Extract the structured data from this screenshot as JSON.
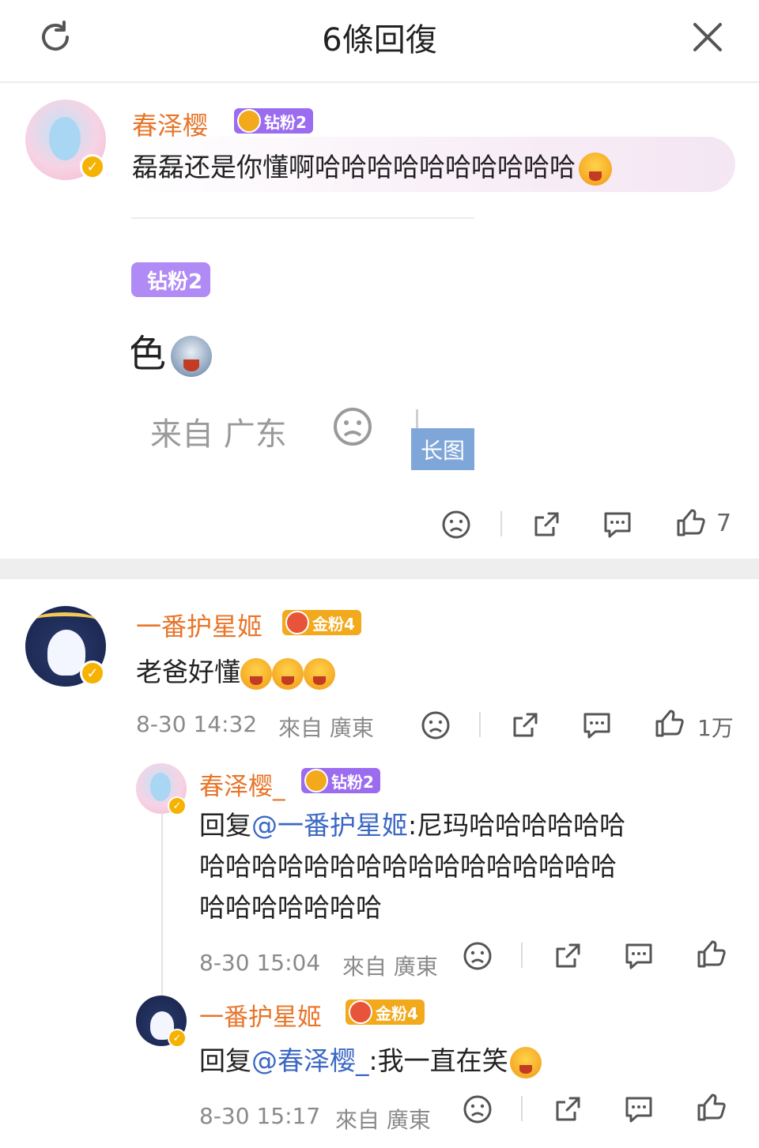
{
  "header": {
    "title": "6條回復",
    "refresh_icon": "refresh-icon",
    "close_icon": "close-icon"
  },
  "comment1": {
    "username": "春泽樱_",
    "fan_badge": "钻粉2",
    "text": "磊磊还是你懂啊哈哈哈哈哈哈哈哈哈哈",
    "image": {
      "badge": "钻粉2",
      "text": "色",
      "meta": "来自 广东",
      "long_image_label": "长图"
    },
    "like_count": "7"
  },
  "comment2": {
    "username": "一番护星姬",
    "fan_badge": "金粉4",
    "text": "老爸好懂",
    "date": "8-30 14:32",
    "location": "來自 廣東",
    "like_count": "1万"
  },
  "reply1": {
    "username": "春泽樱_",
    "fan_badge": "钻粉2",
    "prefix": "回复",
    "mention": "@一番护星姬",
    "line1": ":尼玛哈哈哈哈哈哈",
    "line2": "哈哈哈哈哈哈哈哈哈哈哈哈哈哈哈哈",
    "line3": "哈哈哈哈哈哈哈",
    "date": "8-30 15:04",
    "location": "來自 廣東"
  },
  "reply2": {
    "username": "一番护星姬",
    "fan_badge": "金粉4",
    "prefix": "回复",
    "mention": "@春泽樱_",
    "text": ":我一直在笑",
    "date": "8-30 15:17",
    "location": "來自 廣東"
  },
  "colors": {
    "username": "#e8752a",
    "mention": "#3b68c4",
    "diamond_badge": "#9b6cf0",
    "gold_badge": "#f2a91c"
  }
}
